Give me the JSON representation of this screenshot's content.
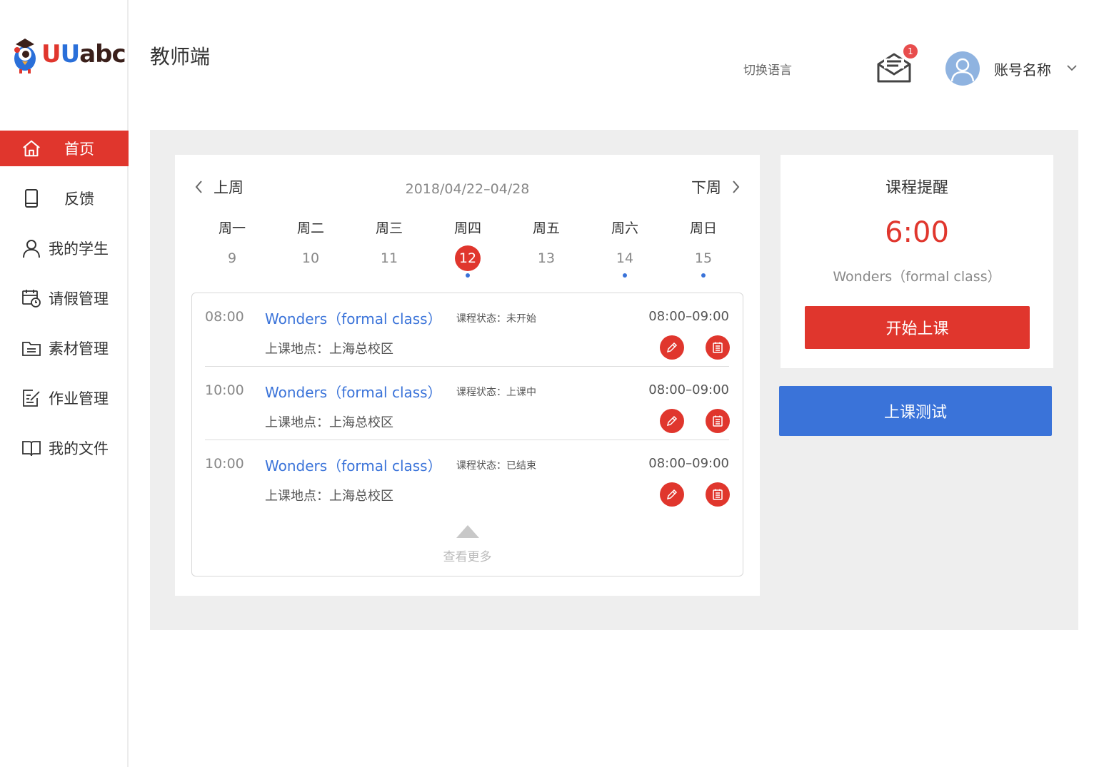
{
  "app": {
    "logo_text": "UUabc",
    "page_title": "教师端"
  },
  "header": {
    "switch_language": "切换语言",
    "mail_badge": "1",
    "account_name": "账号名称"
  },
  "sidebar": {
    "items": [
      {
        "label": "首页",
        "icon": "home-icon",
        "active": true
      },
      {
        "label": "反馈",
        "icon": "tablet-icon"
      },
      {
        "label": "我的学生",
        "icon": "user-icon"
      },
      {
        "label": "请假管理",
        "icon": "calendar-clock-icon"
      },
      {
        "label": "素材管理",
        "icon": "folder-icon"
      },
      {
        "label": "作业管理",
        "icon": "edit-doc-icon"
      },
      {
        "label": "我的文件",
        "icon": "book-icon"
      }
    ]
  },
  "calendar": {
    "prev_label": "上周",
    "next_label": "下周",
    "range": "2018/04/22–04/28",
    "days": [
      {
        "name": "周一",
        "date": "9",
        "selected": false,
        "has_class": false
      },
      {
        "name": "周二",
        "date": "10",
        "selected": false,
        "has_class": false
      },
      {
        "name": "周三",
        "date": "11",
        "selected": false,
        "has_class": false
      },
      {
        "name": "周四",
        "date": "12",
        "selected": true,
        "has_class": true
      },
      {
        "name": "周五",
        "date": "13",
        "selected": false,
        "has_class": false
      },
      {
        "name": "周六",
        "date": "14",
        "selected": false,
        "has_class": true
      },
      {
        "name": "周日",
        "date": "15",
        "selected": false,
        "has_class": true
      }
    ],
    "classes": [
      {
        "time": "08:00",
        "name": "Wonders（formal class）",
        "status": "课程状态：未开始",
        "range": "08:00–09:00",
        "location": "上课地点：上海总校区"
      },
      {
        "time": "10:00",
        "name": "Wonders（formal class）",
        "status": "课程状态：上课中",
        "range": "08:00–09:00",
        "location": "上课地点：上海总校区"
      },
      {
        "time": "10:00",
        "name": "Wonders（formal class）",
        "status": "课程状态：已结束",
        "range": "08:00–09:00",
        "location": "上课地点：上海总校区"
      }
    ],
    "more_label": "查看更多"
  },
  "reminder": {
    "title": "课程提醒",
    "time": "6:00",
    "course": "Wonders（formal class）",
    "start_button": "开始上课"
  },
  "test_button": "上课测试",
  "colors": {
    "accent_red": "#e0362d",
    "accent_blue": "#3a73d9",
    "panel_bg": "#eeeeee"
  }
}
